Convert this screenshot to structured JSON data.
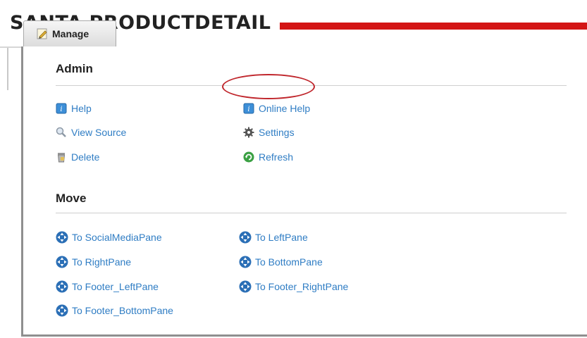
{
  "module": {
    "title": "SANTA PRODUCTDETAIL"
  },
  "manage": {
    "label": "Manage"
  },
  "admin": {
    "title": "Admin",
    "items": [
      {
        "label": "Help",
        "icon": "help-icon"
      },
      {
        "label": "View Source",
        "icon": "magnifier-icon"
      },
      {
        "label": "Delete",
        "icon": "trash-icon"
      },
      {
        "label": "Online Help",
        "icon": "help-icon"
      },
      {
        "label": "Settings",
        "icon": "gear-icon"
      },
      {
        "label": "Refresh",
        "icon": "refresh-icon"
      }
    ]
  },
  "move": {
    "title": "Move",
    "items": [
      {
        "label": "To SocialMediaPane"
      },
      {
        "label": "To RightPane"
      },
      {
        "label": "To Footer_LeftPane"
      },
      {
        "label": "To Footer_BottomPane"
      },
      {
        "label": "To LeftPane"
      },
      {
        "label": "To BottomPane"
      },
      {
        "label": "To Footer_RightPane"
      }
    ]
  },
  "colors": {
    "link": "#2f7dc4",
    "accent_red": "#d31515",
    "highlight": "#c0262c"
  }
}
